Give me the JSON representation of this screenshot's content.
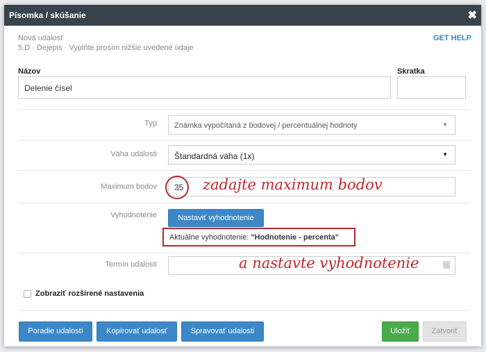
{
  "titlebar": {
    "title": "Písomka / skúšanie",
    "close_icon": "close-icon"
  },
  "header": {
    "line1": "Nová udalosť",
    "line2": "5.D · Dejepis · Vyplňte prosím nižšie uvedené údaje",
    "get_help": "GET HELP"
  },
  "fields": {
    "name_label": "Názov",
    "name_value": "Delenie čísel",
    "short_label": "Skratka",
    "short_value": ""
  },
  "type": {
    "label": "Typ",
    "value": "Známka vypočítaná z bodovej / percentuálnej hodnoty"
  },
  "weight": {
    "label": "Váha udalosti",
    "value": "Štandardná váha (1x)"
  },
  "max_points": {
    "label": "Maximum bodov",
    "value": "35"
  },
  "evaluation": {
    "label": "Vyhodnotenie",
    "button": "Nastaviť vyhodnotenie",
    "current_prefix": "Aktuálne vyhodnotenie: ",
    "current_value": "\"Hodnotenie - percenta\""
  },
  "date": {
    "label": "Termín udalosti",
    "value": ""
  },
  "advanced": {
    "label": "Zobraziť rozšírené nastavenia",
    "checked": false
  },
  "annotations": {
    "max_points": "zadajte maximum bodov",
    "evaluation": "a nastavte vyhodnotenie",
    "color": "#c0272d"
  },
  "footer": {
    "order_button": "Poradie udalostí",
    "copy_button": "Kopírovať udalosť",
    "manage_button": "Spravovať udalosti",
    "save_button": "Uložiť",
    "close_button": "Zatvoriť"
  },
  "colors": {
    "titlebar": "#38434c",
    "primary": "#3c87c8",
    "success": "#4aab4a",
    "link": "#2a8ad6"
  }
}
